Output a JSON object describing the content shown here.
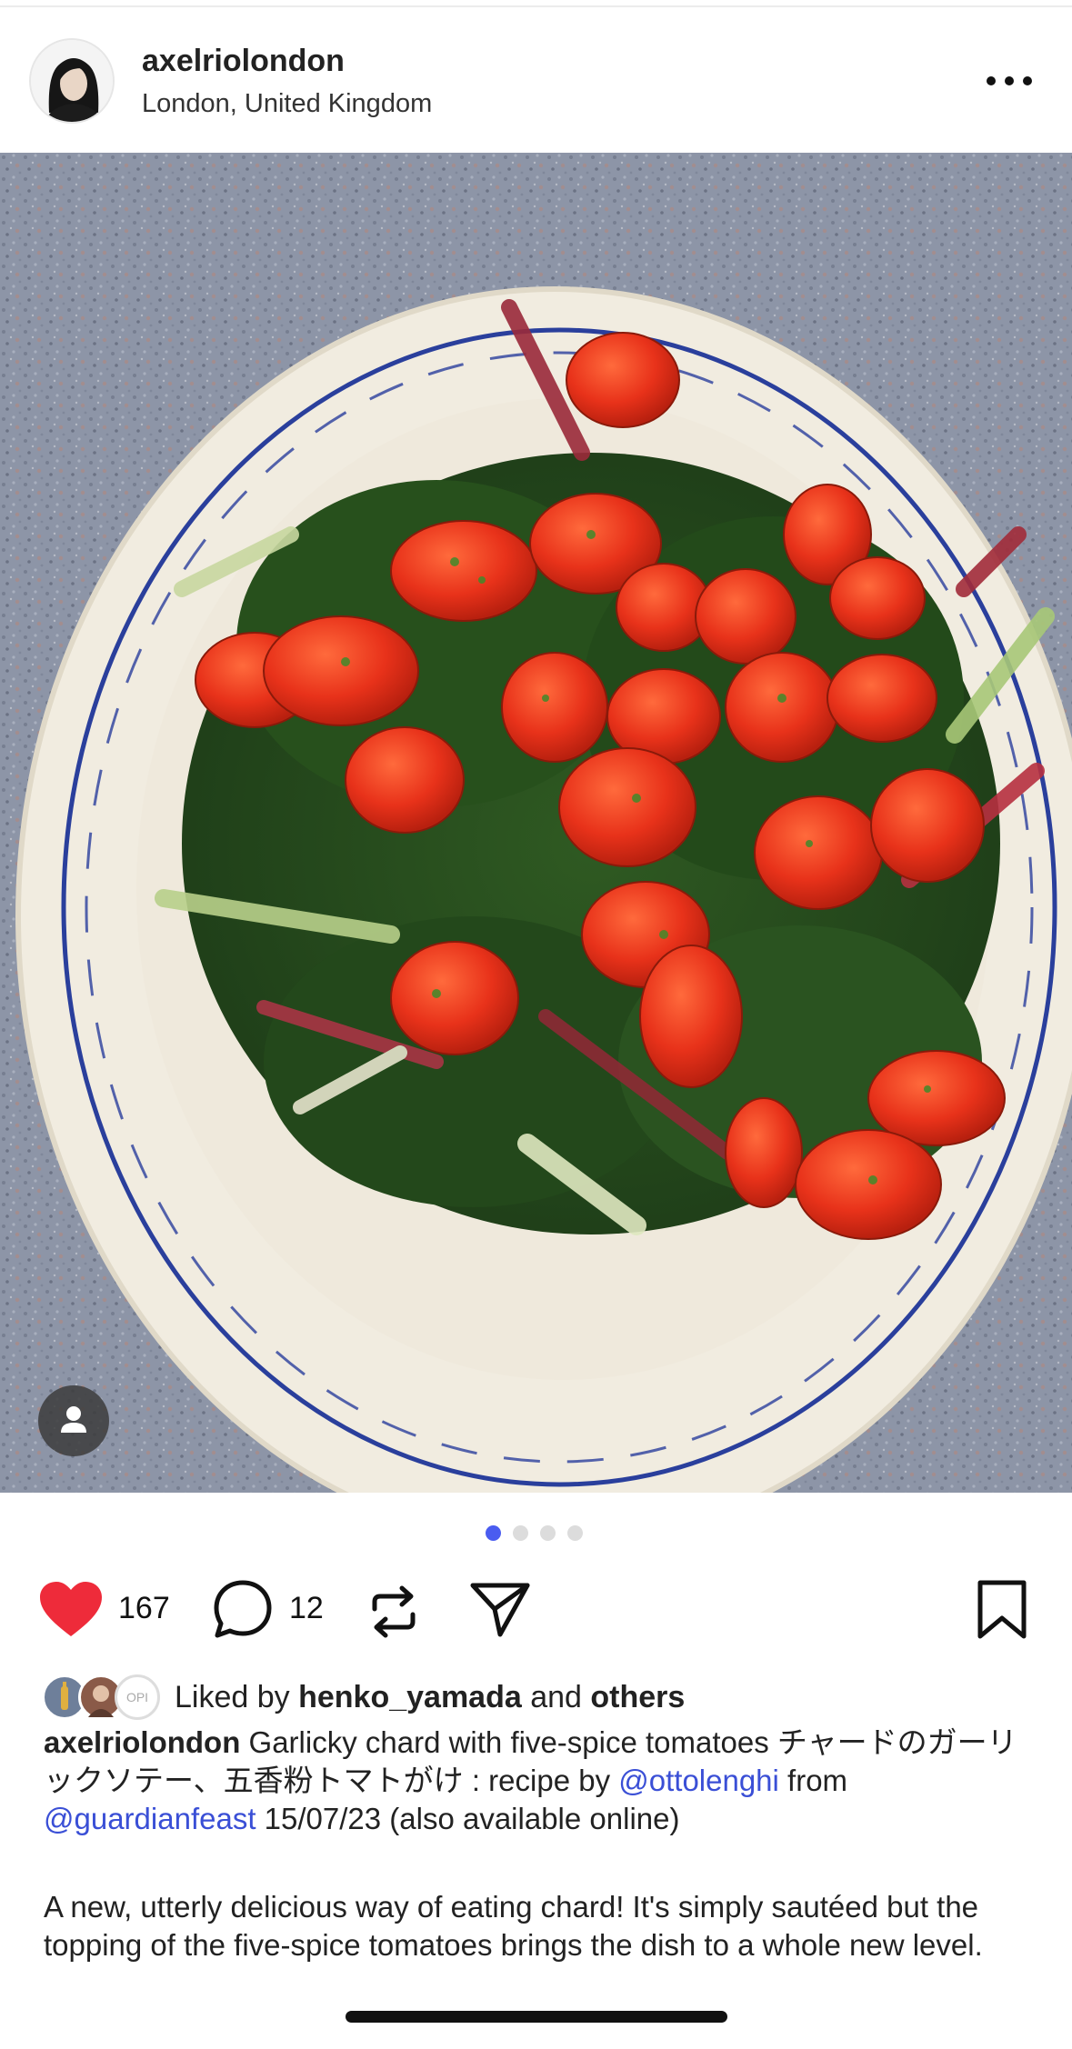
{
  "post": {
    "username": "axelriolondon",
    "location": "London, United Kingdom"
  },
  "photo": {
    "subject": "Plate of garlicky chard with five-spice tomatoes on a blue-patterned bowl"
  },
  "pagination": {
    "total": 4,
    "active": 0,
    "active_color": "#4a5cf0"
  },
  "actions": {
    "like_count": "167",
    "comment_count": "12",
    "like_color": "#ee2b3a"
  },
  "likes": {
    "prefix": "Liked by",
    "user": "henko_yamada",
    "and": "and",
    "others": "others",
    "avatar3_text": "OPI"
  },
  "caption": {
    "username": "axelriolondon",
    "text1": " Garlicky chard with five-spice tomatoes チャードのガーリックソテー、五香粉トマトがけ : recipe by ",
    "mention1": "@ottolenghi",
    "text2": " from ",
    "mention2": "@guardianfeast",
    "text3": " 15/07/23 (also available online)"
  },
  "description": "A new, utterly delicious way of eating chard! It's simply sautéed but the topping of the five-spice tomatoes brings the dish to a whole new level."
}
